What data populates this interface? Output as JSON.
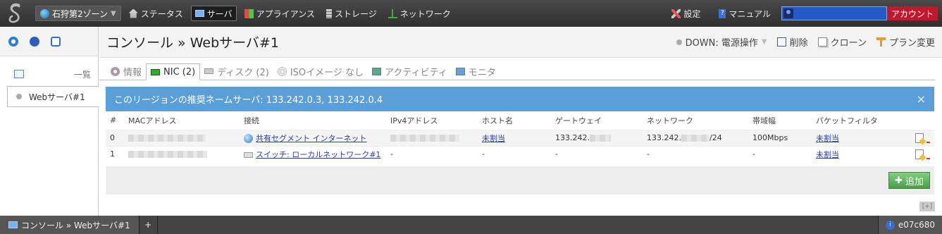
{
  "topbar": {
    "zone": "石狩第2ゾーン",
    "nav": [
      "ステータス",
      "サーバ",
      "アプライアンス",
      "ストレージ",
      "ネットワーク"
    ],
    "settings": "設定",
    "manual": "マニュアル",
    "account": "アカウント"
  },
  "sidebar": {
    "list_label": "一覧",
    "selected_item": "Webサーバ#1"
  },
  "main": {
    "title": "コンソール » Webサーバ#1",
    "status": "DOWN: 電源操作",
    "actions": [
      "削除",
      "クローン",
      "プラン変更"
    ],
    "tabs": [
      "情報",
      "NIC (2)",
      "ディスク (2)",
      "ISOイメージ なし",
      "アクティビティ",
      "モニタ"
    ],
    "alert": "このリージョンの推奨ネームサーバ: 133.242.0.3, 133.242.0.4",
    "alert_close": "×",
    "table": {
      "headers": [
        "#",
        "MACアドレス",
        "接続",
        "IPv4アドレス",
        "ホスト名",
        "ゲートウェイ",
        "ネットワーク",
        "帯域幅",
        "パケットフィルタ"
      ],
      "rows": [
        {
          "idx": "0",
          "connection": "共有セグメント インターネット",
          "ipv4": "",
          "host": "未割当",
          "gateway": "133.242.",
          "network_pre": "133.242.",
          "network_post": "/24",
          "bandwidth": "100Mbps",
          "filter": "未割当"
        },
        {
          "idx": "1",
          "connection": "スイッチ: ローカルネットワーク#1",
          "ipv4": "-",
          "host": "-",
          "gateway": "-",
          "network_pre": "-",
          "network_post": "",
          "bandwidth": "-",
          "filter": "未割当"
        }
      ]
    },
    "add_button": "追加",
    "expand": "[+]"
  },
  "taskbar": {
    "task": "コンソール » Webサーバ#1",
    "plus": "+",
    "build": "e07c680"
  },
  "colors": {
    "accent": "#5b9fd8",
    "account_bg": "#c0182c",
    "add_green": "#4a9e4a"
  }
}
